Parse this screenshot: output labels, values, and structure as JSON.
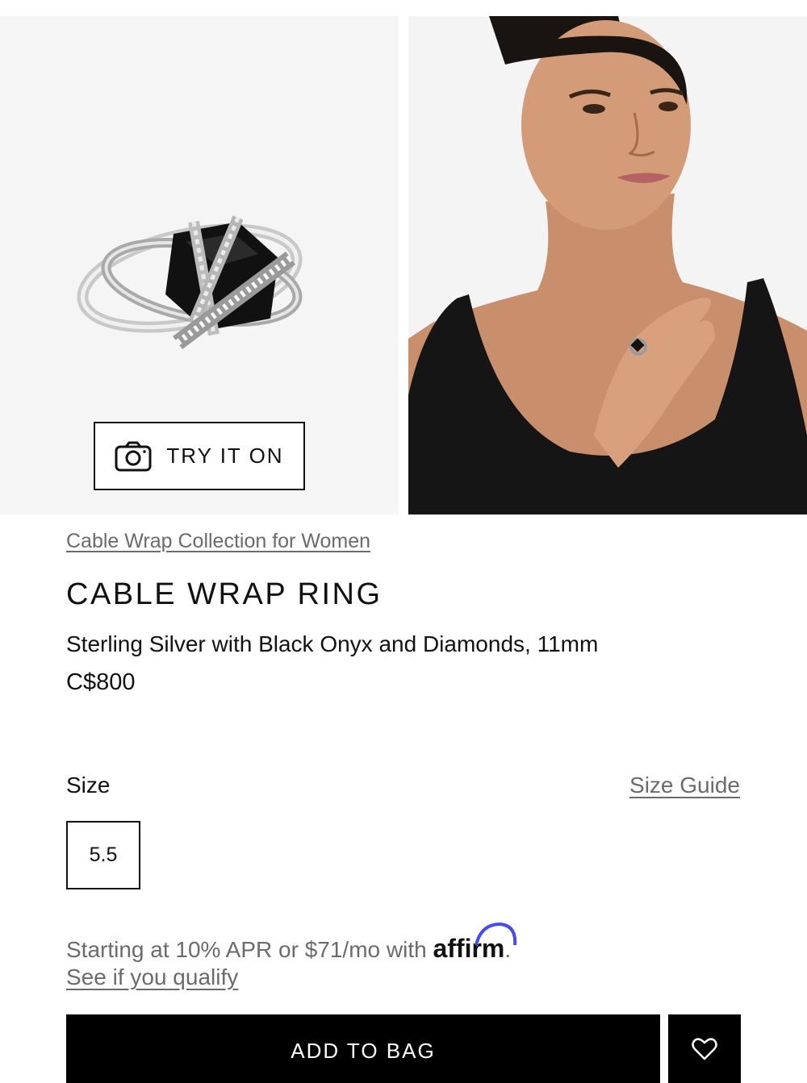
{
  "gallery": {
    "images": [
      {
        "alt": "ring-product-image"
      },
      {
        "alt": "model-wearing-ring-image"
      }
    ],
    "try_it_on_label": "TRY IT ON"
  },
  "product": {
    "collection_link": "Cable Wrap Collection for Women",
    "title": "CABLE WRAP RING",
    "subtitle": "Sterling Silver with Black Onyx and Diamonds, 11mm",
    "price": "C$800"
  },
  "size": {
    "label": "Size",
    "guide_link": "Size Guide",
    "options": [
      "5.5"
    ]
  },
  "financing": {
    "text": "Starting at 10% APR or $71/mo with ",
    "brand": "affirm",
    "trailing": ".",
    "qualify_link": "See if you qualify",
    "brand_color": "#4a4af4"
  },
  "actions": {
    "add_to_bag": "ADD TO BAG",
    "wishlist_icon": "heart-outline-icon"
  }
}
